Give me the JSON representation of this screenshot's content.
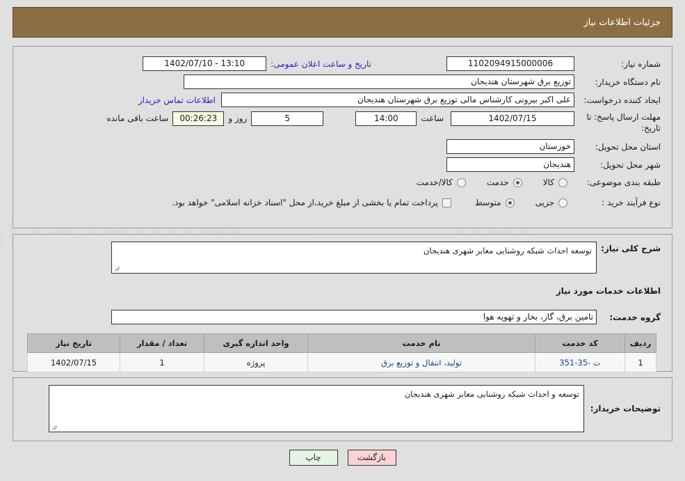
{
  "header": {
    "title": "جزئیات اطلاعات نیاز"
  },
  "summary": {
    "need_number_label": "شماره نیاز:",
    "need_number_value": "1102094915000006",
    "public_announce_label": "تاریخ و ساعت اعلان عمومی:",
    "public_announce_value": "13:10 - 1402/07/10",
    "buyer_org_label": "نام دستگاه خریدار:",
    "buyer_org_value": "توزیع برق شهرستان هندیجان",
    "creator_label": "ایجاد کننده درخواست:",
    "creator_value": "علی اکبر بیرونی کارشناس مالی توزیع برق شهرستان هندیجان",
    "contact_link": "اطلاعات تماس خریدار",
    "deadline_label": "مهلت ارسال پاسخ: تا تاریخ:",
    "deadline_date": "1402/07/15",
    "time_label": "ساعت",
    "time_value": "14:00",
    "days_value": "5",
    "days_label": "روز و",
    "countdown_value": "00:26:23",
    "remaining_label": "ساعت باقی مانده",
    "province_label": "استان محل تحویل:",
    "province_value": "خوزستان",
    "city_label": "شهر محل تحویل:",
    "city_value": "هندیجان",
    "category_label": "طبقه بندی موضوعی:",
    "category_options": [
      {
        "label": "کالا",
        "selected": false
      },
      {
        "label": "خدمت",
        "selected": true
      },
      {
        "label": "کالا/خدمت",
        "selected": false
      }
    ],
    "process_label": "نوع فرآیند خرید :",
    "process_options": [
      {
        "label": "جزیی",
        "selected": false
      },
      {
        "label": "متوسط",
        "selected": true
      }
    ],
    "treasury_checkbox_label": "پرداخت تمام یا بخشی از مبلغ خرید،از محل \"اسناد خزانه اسلامی\" خواهد بود.",
    "treasury_checked": false
  },
  "need_description": {
    "label": "شرح کلی نیاز:",
    "value": "توسعه احداث شبکه روشنایی معابر شهری هندیجان"
  },
  "services_section": {
    "heading": "اطلاعات خدمات مورد نیاز",
    "service_group_label": "گروه خدمت:",
    "service_group_value": "تامین برق، گاز، بخار و تهویه هوا",
    "columns": [
      "ردیف",
      "کد خدمت",
      "نام خدمت",
      "واحد اندازه گیری",
      "تعداد / مقدار",
      "تاریخ نیاز"
    ],
    "rows": [
      {
        "index": "1",
        "code": "ت -35-351",
        "name": "تولید، انتقال و توزیع برق",
        "unit": "پروژه",
        "quantity": "1",
        "need_date": "1402/07/15"
      }
    ]
  },
  "buyer_notes": {
    "label": "توضیحات خریدار:",
    "value": "توسعه و احداث شبکه روشنایی معابر شهری هندیجان"
  },
  "footer": {
    "back_label": "بازگشت",
    "print_label": "چاپ"
  },
  "colors": {
    "header_bg": "#8c6e42",
    "page_bg": "#e0e0e0",
    "link": "#2222cc",
    "back_btn": "#fbd3d3",
    "print_btn": "#e3f5e3"
  }
}
